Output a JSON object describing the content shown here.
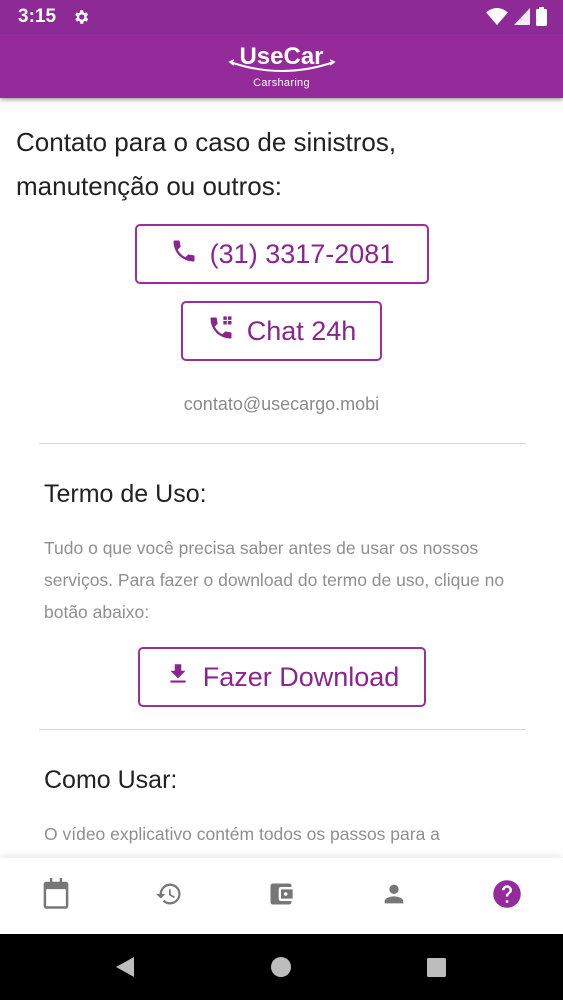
{
  "status_bar": {
    "time": "3:15"
  },
  "app_bar": {
    "logo_text": "UseCar",
    "logo_subtitle": "Carsharing"
  },
  "contact": {
    "title": "Contato para o caso de sinistros, manutenção ou outros:",
    "phone_label": "(31) 3317-2081",
    "chat_label": "Chat 24h",
    "email": "contato@usecargo.mobi"
  },
  "terms": {
    "title": "Termo de Uso:",
    "description": "Tudo o que você precisa saber antes de usar os nossos serviços. Para fazer o download do termo de uso, clique no botão abaixo:",
    "download_label": "Fazer Download"
  },
  "how_to": {
    "title": "Como Usar:",
    "description": "O vídeo explicativo contém todos os passos para a"
  },
  "bottom_nav": {
    "items": [
      {
        "icon": "calendar-icon",
        "active": false
      },
      {
        "icon": "history-icon",
        "active": false
      },
      {
        "icon": "wallet-icon",
        "active": false
      },
      {
        "icon": "person-icon",
        "active": false
      },
      {
        "icon": "help-icon",
        "active": true
      }
    ]
  },
  "colors": {
    "primary": "#952a9b",
    "inactive_icon": "#777777"
  }
}
